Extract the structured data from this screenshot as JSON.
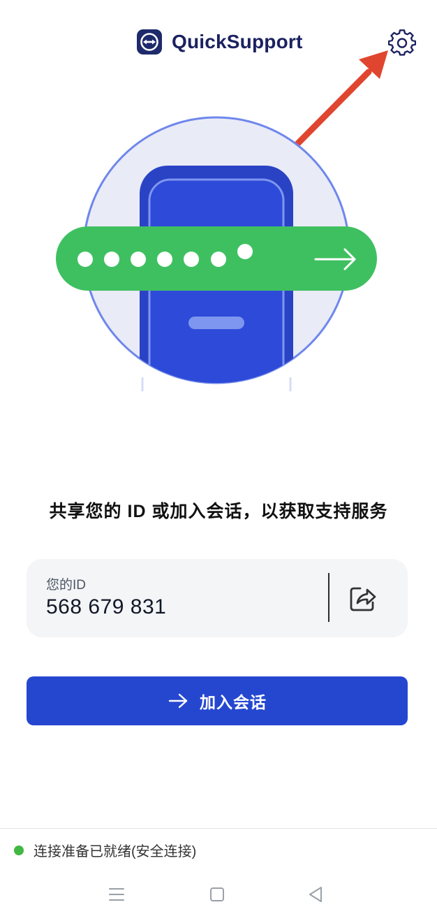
{
  "header": {
    "app_name": "QuickSupport",
    "logo_icon": "teamviewer-logo-icon",
    "settings_icon": "gear-icon"
  },
  "prompt": "共享您的 ID 或加入会话，以获取支持服务",
  "id_card": {
    "label": "您的ID",
    "value": "568 679 831",
    "share_icon": "share-icon"
  },
  "join_button": {
    "label": "加入会话",
    "icon": "arrow-right-icon"
  },
  "status": {
    "text": "连接准备已就绪(安全连接)",
    "color": "#41b843"
  },
  "colors": {
    "brand": "#1b2160",
    "accent": "#2547d0",
    "green": "#3fc060",
    "annotation_arrow": "#e0452f"
  }
}
